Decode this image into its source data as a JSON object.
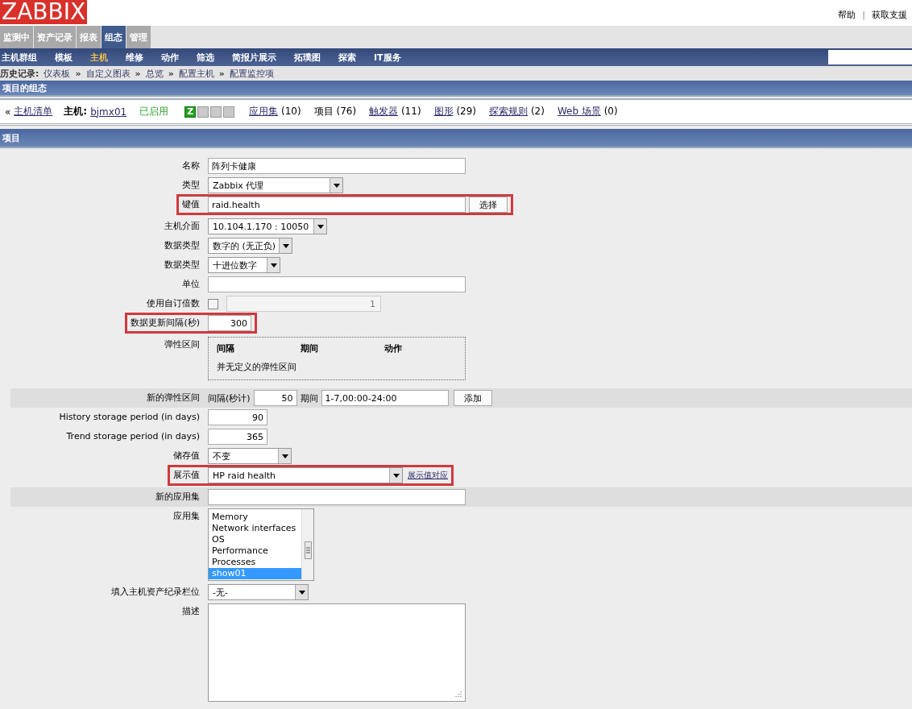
{
  "header": {
    "logo": "ZABBIX",
    "links": [
      {
        "label": "帮助"
      },
      {
        "label": "获取支援"
      }
    ],
    "separator": "|"
  },
  "main_tabs": [
    {
      "label": "监测中",
      "selected": false
    },
    {
      "label": "资产记录",
      "selected": false
    },
    {
      "label": "报表",
      "selected": false
    },
    {
      "label": "组态",
      "selected": true
    },
    {
      "label": "管理",
      "selected": false
    }
  ],
  "sub_menu": [
    {
      "label": "主机群组",
      "selected": false
    },
    {
      "label": "模板",
      "selected": false
    },
    {
      "label": "主机",
      "selected": true
    },
    {
      "label": "维修",
      "selected": false
    },
    {
      "label": "动作",
      "selected": false
    },
    {
      "label": "筛选",
      "selected": false
    },
    {
      "label": "简报片展示",
      "selected": false
    },
    {
      "label": "拓璞图",
      "selected": false
    },
    {
      "label": "探索",
      "selected": false
    },
    {
      "label": "IT服务",
      "selected": false
    }
  ],
  "breadcrumb": {
    "label": "历史记录:",
    "separator": "»",
    "items": [
      "仪表板",
      "自定义图表",
      "总览",
      "配置主机",
      "配置监控项"
    ]
  },
  "page_title": "项目的组态",
  "host_nav": {
    "back_mark": "«",
    "back": "主机清单",
    "host_label": "主机:",
    "host": "bjmx01",
    "status": "已启用",
    "availability": [
      {
        "label": "Z",
        "on": true
      },
      {
        "on": false
      },
      {
        "on": false
      },
      {
        "on": false
      }
    ],
    "links": [
      {
        "label": "应用集",
        "count": "(10)",
        "link": true
      },
      {
        "label": "项目",
        "count": "(76)",
        "link": false
      },
      {
        "label": "触发器",
        "count": "(11)",
        "link": true
      },
      {
        "label": "图形",
        "count": "(29)",
        "link": true
      },
      {
        "label": "探索规则",
        "count": "(2)",
        "link": true
      },
      {
        "label": "Web 场景",
        "count": "(0)",
        "link": true
      }
    ]
  },
  "section_title": "项目",
  "form": [
    {
      "kind": "text",
      "label": "名称",
      "value": "阵列卡健康",
      "highlighted": false
    },
    {
      "kind": "select",
      "label": "类型",
      "value": "Zabbix 代理",
      "highlighted": false
    },
    {
      "kind": "key",
      "label": "键值",
      "value": "raid.health",
      "button": "选择",
      "highlighted": true
    },
    {
      "kind": "select",
      "label": "主机介面",
      "value": "10.104.1.170 : 10050",
      "highlighted": false
    },
    {
      "kind": "select",
      "label": "数据类型",
      "value": "数字的 (无正负)",
      "highlighted": false
    },
    {
      "kind": "select",
      "label": "数据类型",
      "value": "十进位数字",
      "highlighted": false
    },
    {
      "kind": "text",
      "label": "单位",
      "highlighted": false
    },
    {
      "kind": "multiplier",
      "label": "使用自订倍数",
      "checked": false,
      "value": "1",
      "highlighted": false
    },
    {
      "kind": "number",
      "label": "数据更新间隔(秒)",
      "value": "300",
      "highlighted": true
    },
    {
      "kind": "flex_table",
      "label": "弹性区间",
      "columns": [
        "间隔",
        "期间",
        "动作"
      ],
      "empty": "并无定义的弹性区间",
      "highlighted": false
    },
    {
      "kind": "new_flex",
      "label": "新的弹性区间",
      "interval_label": "间隔(秒计)",
      "interval": "50",
      "period_label": "期间",
      "period": "1-7,00:00-24:00",
      "button": "添加",
      "highlighted": false
    },
    {
      "kind": "number",
      "label": "History storage period (in days)",
      "value": "90",
      "highlighted": false
    },
    {
      "kind": "number",
      "label": "Trend storage period (in days)",
      "value": "365",
      "highlighted": false
    },
    {
      "kind": "select",
      "label": "储存值",
      "value": "不变",
      "highlighted": false
    },
    {
      "kind": "select_link",
      "label": "展示值",
      "value": "HP raid health",
      "link": "展示值对应",
      "highlighted": true
    },
    {
      "kind": "text",
      "label": "新的应用集",
      "shaded": true,
      "highlighted": false
    },
    {
      "kind": "listbox",
      "label": "应用集",
      "items": [
        {
          "label": "Memory",
          "selected": false
        },
        {
          "label": "Network interfaces",
          "selected": false
        },
        {
          "label": "OS",
          "selected": false
        },
        {
          "label": "Performance",
          "selected": false
        },
        {
          "label": "Processes",
          "selected": false
        },
        {
          "label": "show01",
          "selected": true
        }
      ],
      "highlighted": false
    },
    {
      "kind": "select",
      "label": "填入主机资产纪录栏位",
      "value": "-无-",
      "highlighted": false
    },
    {
      "kind": "textarea",
      "label": "描述",
      "highlighted": false
    }
  ]
}
